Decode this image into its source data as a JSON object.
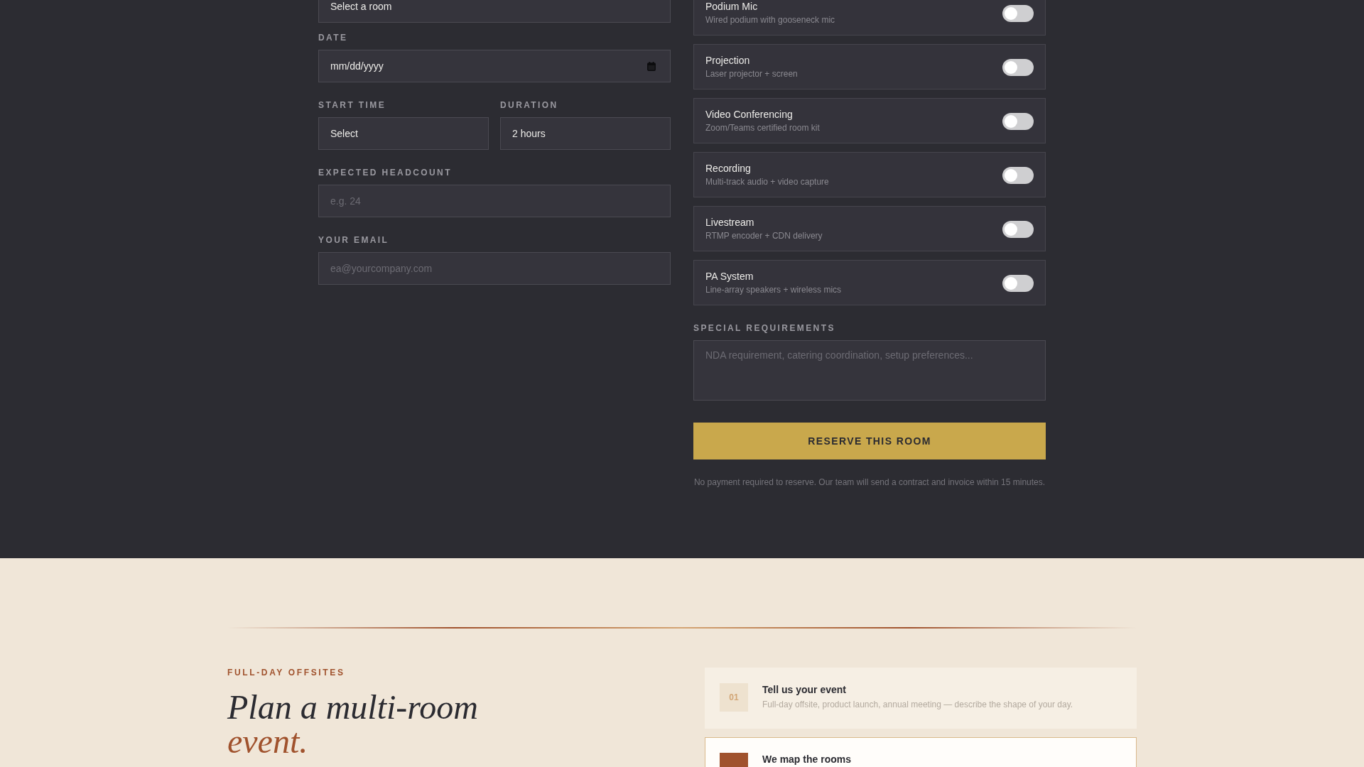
{
  "booking_form": {
    "fields": [
      {
        "kind": "select",
        "value": "Select a room"
      },
      {
        "kind": "date",
        "label": "DATE",
        "placeholder": "mm/dd/yyyy"
      },
      {
        "kind": "row",
        "fields": [
          {
            "kind": "select",
            "label": "START TIME",
            "value": "Select"
          },
          {
            "kind": "select",
            "label": "DURATION",
            "value": "2 hours"
          }
        ]
      },
      {
        "kind": "input",
        "label": "EXPECTED HEADCOUNT",
        "placeholder": "e.g. 24"
      },
      {
        "kind": "input",
        "label": "YOUR EMAIL",
        "placeholder": "ea@yourcompany.com"
      }
    ]
  },
  "equipment": [
    {
      "name": "Podium Mic",
      "description": "Wired podium with gooseneck mic",
      "on": false
    },
    {
      "name": "Projection",
      "description": "Laser projector + screen",
      "on": false
    },
    {
      "name": "Video Conferencing",
      "description": "Zoom/Teams certified room kit",
      "on": false
    },
    {
      "name": "Recording",
      "description": "Multi-track audio + video capture",
      "on": false
    },
    {
      "name": "Livestream",
      "description": "RTMP encoder + CDN delivery",
      "on": false
    },
    {
      "name": "PA System",
      "description": "Line-array speakers + wireless mics",
      "on": false
    }
  ],
  "special_requirements": {
    "label": "SPECIAL REQUIREMENTS",
    "placeholder": "NDA requirement, catering coordination, setup preferences..."
  },
  "reserve_button": "RESERVE THIS ROOM",
  "reserve_note": "No payment required to reserve. Our team will send a contract and invoice within 15 minutes.",
  "offsites": {
    "eyebrow": "FULL-DAY OFFSITES",
    "heading": "Plan a multi-room",
    "heading_accent": "event.",
    "steps": [
      {
        "number": "01",
        "title": "Tell us your event",
        "description": "Full-day offsite, product launch, annual meeting — describe the shape of your day.",
        "active": false
      },
      {
        "title": "We map the rooms",
        "active": true
      }
    ]
  }
}
